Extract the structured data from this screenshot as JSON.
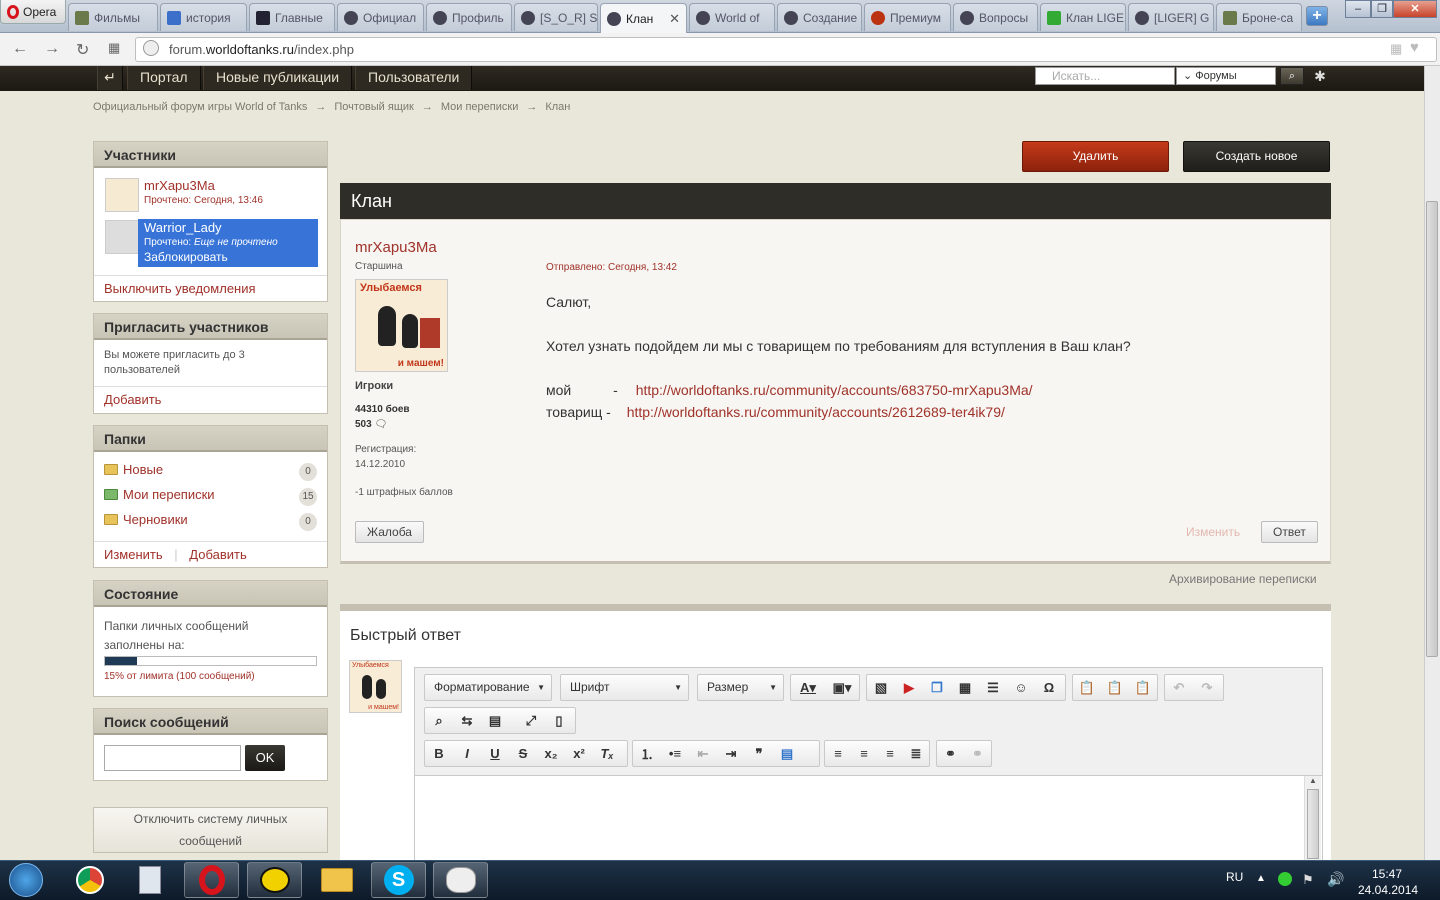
{
  "browser": {
    "menu_label": "Opera",
    "tabs": [
      {
        "label": "Фильмы",
        "icon": "tank-icon"
      },
      {
        "label": "история",
        "icon": "google-icon"
      },
      {
        "label": "Главные",
        "icon": "news-icon"
      },
      {
        "label": "Официал",
        "icon": "wot-icon"
      },
      {
        "label": "Профиль",
        "icon": "wot-icon"
      },
      {
        "label": "[S_O_R] S",
        "icon": "wot-icon"
      },
      {
        "label": "Клан",
        "icon": "wot-icon",
        "active": true
      },
      {
        "label": "World of",
        "icon": "wot-icon"
      },
      {
        "label": "Создание",
        "icon": "wot-icon"
      },
      {
        "label": "Премиум",
        "icon": "premium-icon"
      },
      {
        "label": "Вопросы",
        "icon": "wot-icon"
      },
      {
        "label": "Клан LIGE",
        "icon": "clan-icon"
      },
      {
        "label": "[LIGER] G",
        "icon": "wot-icon"
      },
      {
        "label": "Броне-са",
        "icon": "tank-icon"
      }
    ],
    "url_prefix": "forum.",
    "url_domain": "worldoftanks.ru",
    "url_path": "/index.php"
  },
  "forum_nav": {
    "items": [
      "Портал",
      "Новые публикации",
      "Пользователи"
    ],
    "search_placeholder": "Искать...",
    "search_scope": "Форумы"
  },
  "breadcrumb": [
    "Официальный форум игры World of Tanks",
    "Почтовый ящик",
    "Мои переписки",
    "Клан"
  ],
  "sidebar": {
    "participants": {
      "title": "Участники",
      "users": [
        {
          "name": "mrXapu3Ma",
          "status": "Прочтено: Сегодня, 13:46"
        },
        {
          "name": "Warrior_Lady",
          "status_label": "Прочтено:",
          "status_value": "Еще не прочтено",
          "action": "Заблокировать"
        }
      ],
      "footer": "Выключить уведомления"
    },
    "invite": {
      "title": "Пригласить участников",
      "text": "Вы можете пригласить до 3 пользователей",
      "footer": "Добавить"
    },
    "folders": {
      "title": "Папки",
      "items": [
        {
          "label": "Новые",
          "count": "0"
        },
        {
          "label": "Мои переписки",
          "count": "15"
        },
        {
          "label": "Черновики",
          "count": "0"
        }
      ],
      "edit": "Изменить",
      "add": "Добавить"
    },
    "status": {
      "title": "Состояние",
      "text": "Папки личных сообщений заполнены на:",
      "progress": 0.15,
      "limit_text": "15% от лимита (100 сообщений)"
    },
    "search": {
      "title": "Поиск сообщений",
      "button": "OK"
    },
    "disable_button": "Отключить систему личных сообщений"
  },
  "actions": {
    "delete": "Удалить",
    "create": "Создать новое"
  },
  "message": {
    "topic": "Клан",
    "author": "mrXapu3Ma",
    "rank": "Старшина",
    "avatar_caption_top": "Улыбаемся",
    "avatar_caption_bottom": "и машем!",
    "group": "Игроки",
    "battles": "44310 боев",
    "posts": "503",
    "reg_label": "Регистрация:",
    "reg_date": "14.12.2010",
    "penalty": "-1 штрафных баллов",
    "sent": "Отправлено: Сегодня, 13:42",
    "greeting": "Салют,",
    "body": "Хотел узнать подойдем ли мы с товарищем по требованиям для вступления в Ваш клан?",
    "line1_label": "мой",
    "line1_dash": "-",
    "line1_link": "http://worldoftanks.ru/community/accounts/683750-mrXapu3Ma/",
    "line2_label": "товарищ -",
    "line2_link": "http://worldoftanks.ru/community/accounts/2612689-ter4ik79/",
    "report": "Жалоба",
    "edit": "Изменить",
    "reply": "Ответ"
  },
  "archive_link": "Архивирование переписки",
  "quick_reply": {
    "title": "Быстрый ответ",
    "avatar_caption_top": "Улыбаемся",
    "avatar_caption_bottom": "и машем!",
    "format": "Форматирование",
    "font": "Шрифт",
    "size": "Размер"
  },
  "taskbar": {
    "lang": "RU",
    "time": "15:47",
    "date": "24.04.2014"
  }
}
